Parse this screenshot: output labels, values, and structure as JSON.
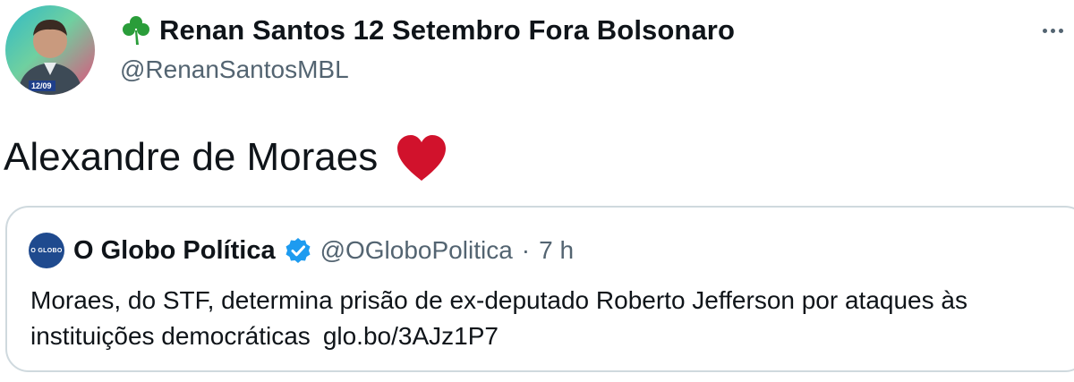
{
  "author": {
    "display_name": "Renan Santos 12 Setembro Fora Bolsonaro",
    "handle": "@RenanSantosMBL",
    "name_emoji": "shamrock-icon",
    "avatar_badge_text": "12/09"
  },
  "tweet": {
    "text": "Alexandre de Moraes",
    "emoji": "red-heart-icon"
  },
  "quoted": {
    "account_name": "O Globo Política",
    "verified": true,
    "handle": "@OGloboPolitica",
    "separator": "·",
    "time": "7 h",
    "text": "Moraes, do STF, determina prisão de ex-deputado Roberto Jefferson por ataques às instituições democráticas",
    "link": "glo.bo/3AJz1P7",
    "avatar_text": "O GLOBO"
  },
  "colors": {
    "text_primary": "#0f1419",
    "text_secondary": "#536471",
    "border": "#cfd9de",
    "heart": "#d1122c",
    "verified": "#1d9bf0",
    "clover": "#2a9d3a",
    "globo_blue": "#1f4a8e"
  }
}
